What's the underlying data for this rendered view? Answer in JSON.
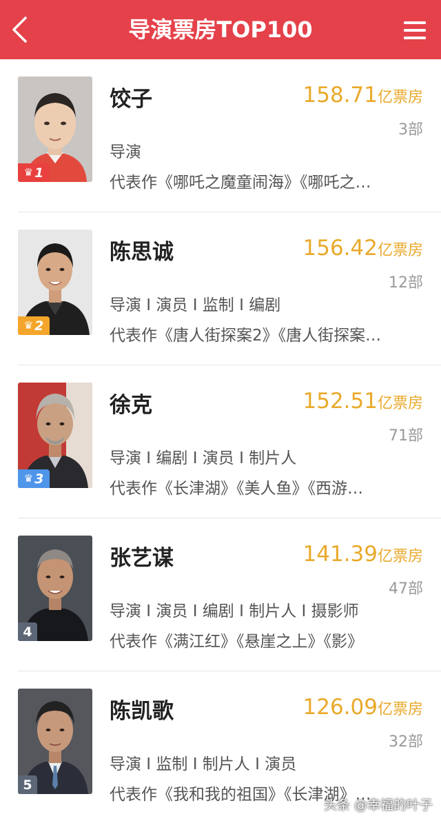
{
  "header": {
    "title": "导演票房TOP100",
    "back_icon": "chevron-left-icon",
    "menu_icon": "hamburger-menu-icon",
    "background_color": "#e5414a"
  },
  "box_office_color": "#e9a92b",
  "directors": [
    {
      "rank": "1",
      "name": "饺子",
      "box_office": "158.71",
      "box_office_unit": "亿票房",
      "film_count": "3部",
      "roles": "导演",
      "works": "代表作《哪吒之魔童闹海》《哪吒之…",
      "badge_color": "#e8403e"
    },
    {
      "rank": "2",
      "name": "陈思诚",
      "box_office": "156.42",
      "box_office_unit": "亿票房",
      "film_count": "12部",
      "roles": "导演 I 演员 I 监制 I 编剧",
      "works": "代表作《唐人街探案2》《唐人街探案…",
      "badge_color": "#f3a62b"
    },
    {
      "rank": "3",
      "name": "徐克",
      "box_office": "152.51",
      "box_office_unit": "亿票房",
      "film_count": "71部",
      "roles": "导演 I 编剧 I 演员 I 制片人",
      "works": "代表作《长津湖》《美人鱼》《西游…",
      "badge_color": "#4f95ea"
    },
    {
      "rank": "4",
      "name": "张艺谋",
      "box_office": "141.39",
      "box_office_unit": "亿票房",
      "film_count": "47部",
      "roles": "导演 I 演员 I 编剧 I 制片人 I 摄影师",
      "works": "代表作《满江红》《悬崖之上》《影》",
      "badge_color": "#5c6676"
    },
    {
      "rank": "5",
      "name": "陈凯歌",
      "box_office": "126.09",
      "box_office_unit": "亿票房",
      "film_count": "32部",
      "roles": "导演 I 监制 I 制片人 I 演员",
      "works": "代表作《我和我的祖国》《长津湖》…",
      "badge_color": "#5c6676"
    }
  ],
  "watermark": "头条 @幸福的叶子"
}
